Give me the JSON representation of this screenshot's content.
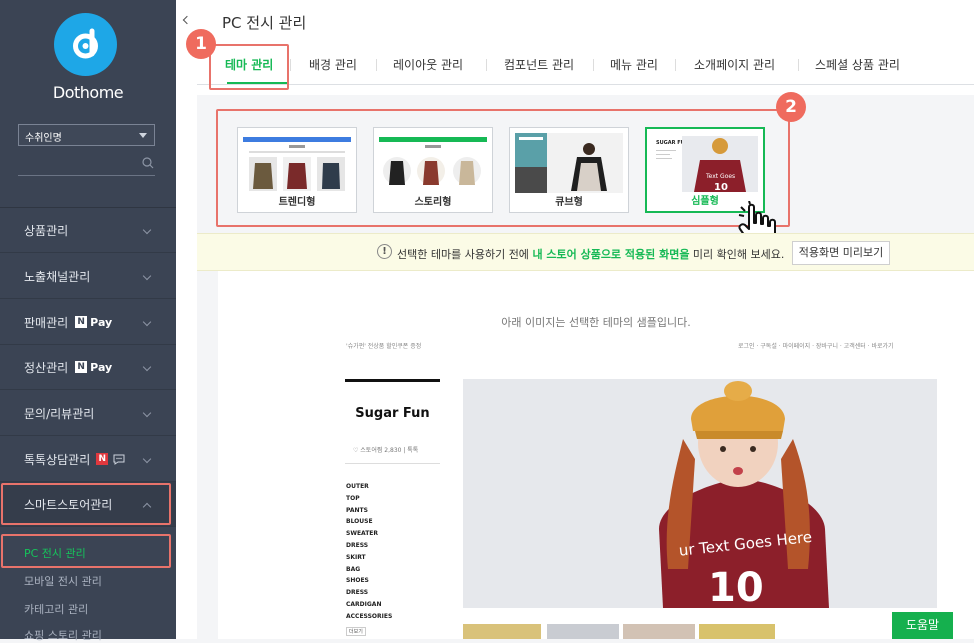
{
  "brand": {
    "name": "Dothome",
    "logo_color": "#1ea7e7"
  },
  "sidebar": {
    "store_select": {
      "value": "수취인명"
    },
    "search": {
      "placeholder": ""
    },
    "items": [
      {
        "label": "상품관리"
      },
      {
        "label": "노출채널관리"
      },
      {
        "label": "판매관리",
        "badge": "Pay"
      },
      {
        "label": "정산관리",
        "badge": "Pay"
      },
      {
        "label": "문의/리뷰관리"
      },
      {
        "label": "톡톡상담관리"
      },
      {
        "label": "스마트스토어관리"
      }
    ],
    "npay_n": "N",
    "talk_badge": "N",
    "sub_items": [
      {
        "label": "PC 전시 관리",
        "active": true
      },
      {
        "label": "모바일 전시 관리"
      },
      {
        "label": "카테고리 관리"
      },
      {
        "label": "쇼핑 스토리 관리"
      }
    ]
  },
  "header": {
    "title": "PC 전시 관리"
  },
  "tabs": [
    {
      "label": "테마 관리",
      "active": true
    },
    {
      "label": "배경 관리"
    },
    {
      "label": "레이아웃 관리"
    },
    {
      "label": "컴포넌트 관리"
    },
    {
      "label": "메뉴 관리"
    },
    {
      "label": "소개페이지 관리"
    },
    {
      "label": "스페셜 상품 관리"
    }
  ],
  "callouts": {
    "one": "1",
    "two": "2"
  },
  "themes": [
    {
      "label": "트렌디형"
    },
    {
      "label": "스토리형"
    },
    {
      "label": "큐브형"
    },
    {
      "label": "심플형",
      "selected": true
    }
  ],
  "notice": {
    "icon": "!",
    "prefix": "선택한 테마를 사용하기 전에 ",
    "highlight": "내 스토어 상품으로 적용된 화면을",
    "suffix": " 미리 확인해 보세요.",
    "button": "적용화면 미리보기"
  },
  "sample": {
    "caption": "아래 이미지는 선택한 테마의 샘플입니다.",
    "top_left": "'슈가펀' 전상품 할인쿠폰 증정",
    "top_right": "로그인 · 구독설 · 마이페이지 · 장바구니 · 고객센터 · 바로가기",
    "store_name": "Sugar Fun",
    "store_meta": "♡ 스토어찜 2,830  |  톡톡",
    "categories": [
      "OUTER",
      "TOP",
      "PANTS",
      "BLOUSE",
      "SWEATER",
      "DRESS",
      "SKIRT",
      "BAG",
      "SHOES",
      "DRESS",
      "CARDIGAN",
      "ACCESSORIES"
    ],
    "more": "더보기",
    "hero_shirt_text": "ur Text Goes Here",
    "hero_number": "10"
  },
  "help_button": "도움말",
  "colors": {
    "accent": "#16b955",
    "highlight": "#e8736b",
    "callout": "#ef6b5e",
    "sidebar_bg": "#3b4454"
  }
}
